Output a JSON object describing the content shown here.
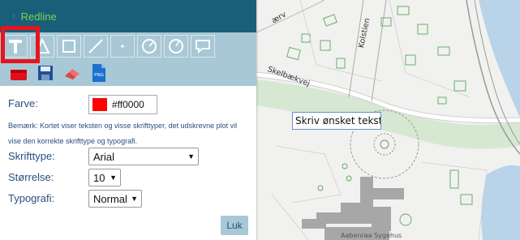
{
  "panel": {
    "title": "Redline",
    "back_icon": "chevron-left-icon",
    "tools_row1": [
      "text-tool-icon",
      "polygon-tool-icon",
      "rectangle-tool-icon",
      "line-tool-icon",
      "point-tool-icon",
      "circle-tool-icon",
      "radius-circle-tool-icon",
      "speech-bubble-tool-icon"
    ],
    "tools_row2": [
      "delete-icon",
      "save-icon",
      "eraser-icon",
      "png-export-icon"
    ],
    "png_label": "PNG",
    "selected_tool": "text"
  },
  "form": {
    "color_label": "Farve:",
    "color_value": "#ff0000",
    "color_text": "#ff0000",
    "note": "Bemærk: Kortet viser teksten og visse skrifttyper, det udskrevne plot vil vise den korrekte skrifttype og typografi.",
    "font_label": "Skrifttype:",
    "font_value": "Arial",
    "size_label": "Størrelse:",
    "size_value": "10",
    "style_label": "Typografi:",
    "style_value": "Normal",
    "close_label": "Luk"
  },
  "map": {
    "text_input_value": "Skriv ønsket tekst",
    "labels": {
      "kolstien": "Kolstien",
      "skelbaek": "Skelbækvej",
      "aerv": "ærv",
      "building": "Aabenraa Sygehus"
    }
  },
  "colors": {
    "header_bg": "#1b5e7a",
    "title": "#79d34b",
    "toolbar_bg": "#a9c8d6",
    "highlight": "#e8141c",
    "label_text": "#2a4e7f"
  }
}
